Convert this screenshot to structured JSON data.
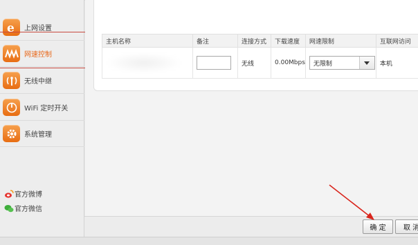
{
  "sidebar": {
    "items": [
      {
        "label": "上网设置",
        "icon": "ie-icon",
        "active": false
      },
      {
        "label": "网速控制",
        "icon": "speed-wave-icon",
        "active": true
      },
      {
        "label": "无线中继",
        "icon": "wireless-relay-icon",
        "active": false
      },
      {
        "label": "WiFi 定时开关",
        "icon": "timer-power-icon",
        "active": false
      },
      {
        "label": "系统管理",
        "icon": "gear-icon",
        "active": false
      }
    ],
    "social": [
      {
        "label": "官方微博",
        "icon": "weibo-icon"
      },
      {
        "label": "官方微信",
        "icon": "wechat-icon"
      }
    ]
  },
  "table": {
    "headers": [
      "主机名称",
      "备注",
      "连接方式",
      "下载速度",
      "网速限制",
      "互联网访问"
    ],
    "rows": [
      {
        "host": "",
        "note": "",
        "connection": "无线",
        "download": "0.00Mbps",
        "limit": "无限制",
        "access": "本机"
      }
    ]
  },
  "buttons": {
    "confirm": "确 定",
    "cancel": "取 消"
  },
  "colors": {
    "accent": "#e8681a",
    "annotation_red": "#d9251c",
    "icon_orange": "#f08a2c"
  }
}
